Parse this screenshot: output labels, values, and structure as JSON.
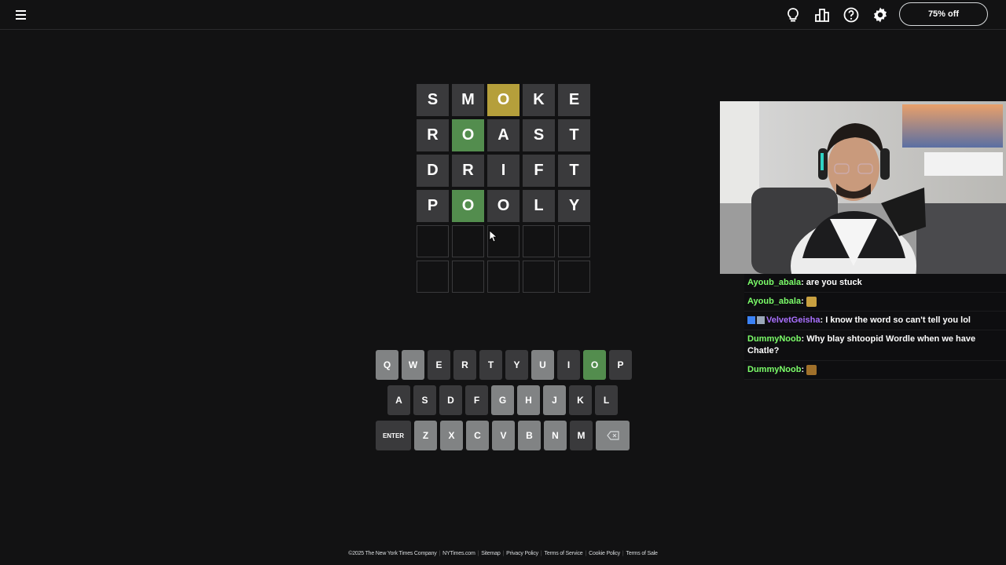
{
  "topbar": {
    "promo_label": "75% off",
    "icons": [
      "menu-icon",
      "lightbulb-icon",
      "stats-icon",
      "help-icon",
      "settings-icon"
    ]
  },
  "board": {
    "rows": [
      [
        {
          "l": "S",
          "s": "absent"
        },
        {
          "l": "M",
          "s": "absent"
        },
        {
          "l": "O",
          "s": "present"
        },
        {
          "l": "K",
          "s": "absent"
        },
        {
          "l": "E",
          "s": "absent"
        }
      ],
      [
        {
          "l": "R",
          "s": "absent"
        },
        {
          "l": "O",
          "s": "correct"
        },
        {
          "l": "A",
          "s": "absent"
        },
        {
          "l": "S",
          "s": "absent"
        },
        {
          "l": "T",
          "s": "absent"
        }
      ],
      [
        {
          "l": "D",
          "s": "absent"
        },
        {
          "l": "R",
          "s": "absent"
        },
        {
          "l": "I",
          "s": "absent"
        },
        {
          "l": "F",
          "s": "absent"
        },
        {
          "l": "T",
          "s": "absent"
        }
      ],
      [
        {
          "l": "P",
          "s": "absent"
        },
        {
          "l": "O",
          "s": "correct"
        },
        {
          "l": "O",
          "s": "absent"
        },
        {
          "l": "L",
          "s": "absent"
        },
        {
          "l": "Y",
          "s": "absent"
        }
      ],
      [
        {
          "l": "",
          "s": "empty"
        },
        {
          "l": "",
          "s": "empty"
        },
        {
          "l": "",
          "s": "empty"
        },
        {
          "l": "",
          "s": "empty"
        },
        {
          "l": "",
          "s": "empty"
        }
      ],
      [
        {
          "l": "",
          "s": "empty"
        },
        {
          "l": "",
          "s": "empty"
        },
        {
          "l": "",
          "s": "empty"
        },
        {
          "l": "",
          "s": "empty"
        },
        {
          "l": "",
          "s": "empty"
        }
      ]
    ]
  },
  "keyboard": {
    "rows": [
      [
        {
          "k": "Q",
          "s": "untried"
        },
        {
          "k": "W",
          "s": "untried"
        },
        {
          "k": "E",
          "s": "absent"
        },
        {
          "k": "R",
          "s": "absent"
        },
        {
          "k": "T",
          "s": "absent"
        },
        {
          "k": "Y",
          "s": "absent"
        },
        {
          "k": "U",
          "s": "untried"
        },
        {
          "k": "I",
          "s": "absent"
        },
        {
          "k": "O",
          "s": "correct"
        },
        {
          "k": "P",
          "s": "absent"
        }
      ],
      [
        {
          "k": "A",
          "s": "absent"
        },
        {
          "k": "S",
          "s": "absent"
        },
        {
          "k": "D",
          "s": "absent"
        },
        {
          "k": "F",
          "s": "absent"
        },
        {
          "k": "G",
          "s": "untried"
        },
        {
          "k": "H",
          "s": "untried"
        },
        {
          "k": "J",
          "s": "untried"
        },
        {
          "k": "K",
          "s": "absent"
        },
        {
          "k": "L",
          "s": "absent"
        }
      ],
      [
        {
          "k": "ENTER",
          "s": "wide"
        },
        {
          "k": "Z",
          "s": "untried"
        },
        {
          "k": "X",
          "s": "untried"
        },
        {
          "k": "C",
          "s": "untried"
        },
        {
          "k": "V",
          "s": "untried"
        },
        {
          "k": "B",
          "s": "untried"
        },
        {
          "k": "N",
          "s": "untried"
        },
        {
          "k": "M",
          "s": "absent"
        },
        {
          "k": "",
          "s": "back"
        }
      ]
    ]
  },
  "chat": {
    "messages": [
      {
        "user": "Ayoub_abala",
        "color": "green",
        "text": "are you stuck",
        "emote": false,
        "badges": false
      },
      {
        "user": "Ayoub_abala",
        "color": "green",
        "text": "",
        "emote": true,
        "emote_color": "#c8a040",
        "badges": false
      },
      {
        "user": "VelvetGeisha",
        "color": "purple",
        "text": "I know the word so can't tell you lol",
        "emote": false,
        "badges": true
      },
      {
        "user": "DummyNoob",
        "color": "green",
        "text": "Why blay shtoopid Wordle when we have Chatle?",
        "emote": false,
        "badges": false
      },
      {
        "user": "DummyNoob",
        "color": "green",
        "text": "",
        "emote": true,
        "emote_color": "#a0702a",
        "badges": false
      }
    ]
  },
  "footer": {
    "items": [
      "©2025 The New York Times Company",
      "NYTimes.com",
      "Sitemap",
      "Privacy Policy",
      "Terms of Service",
      "Cookie Policy",
      "Terms of Sale"
    ]
  },
  "colors": {
    "background": "#121213",
    "absent": "#3a3a3c",
    "present": "#b59f3b",
    "correct": "#538d4e",
    "key_untried": "#818384",
    "chat_user_green": "#7cff6a",
    "chat_user_purple": "#a970ff"
  }
}
